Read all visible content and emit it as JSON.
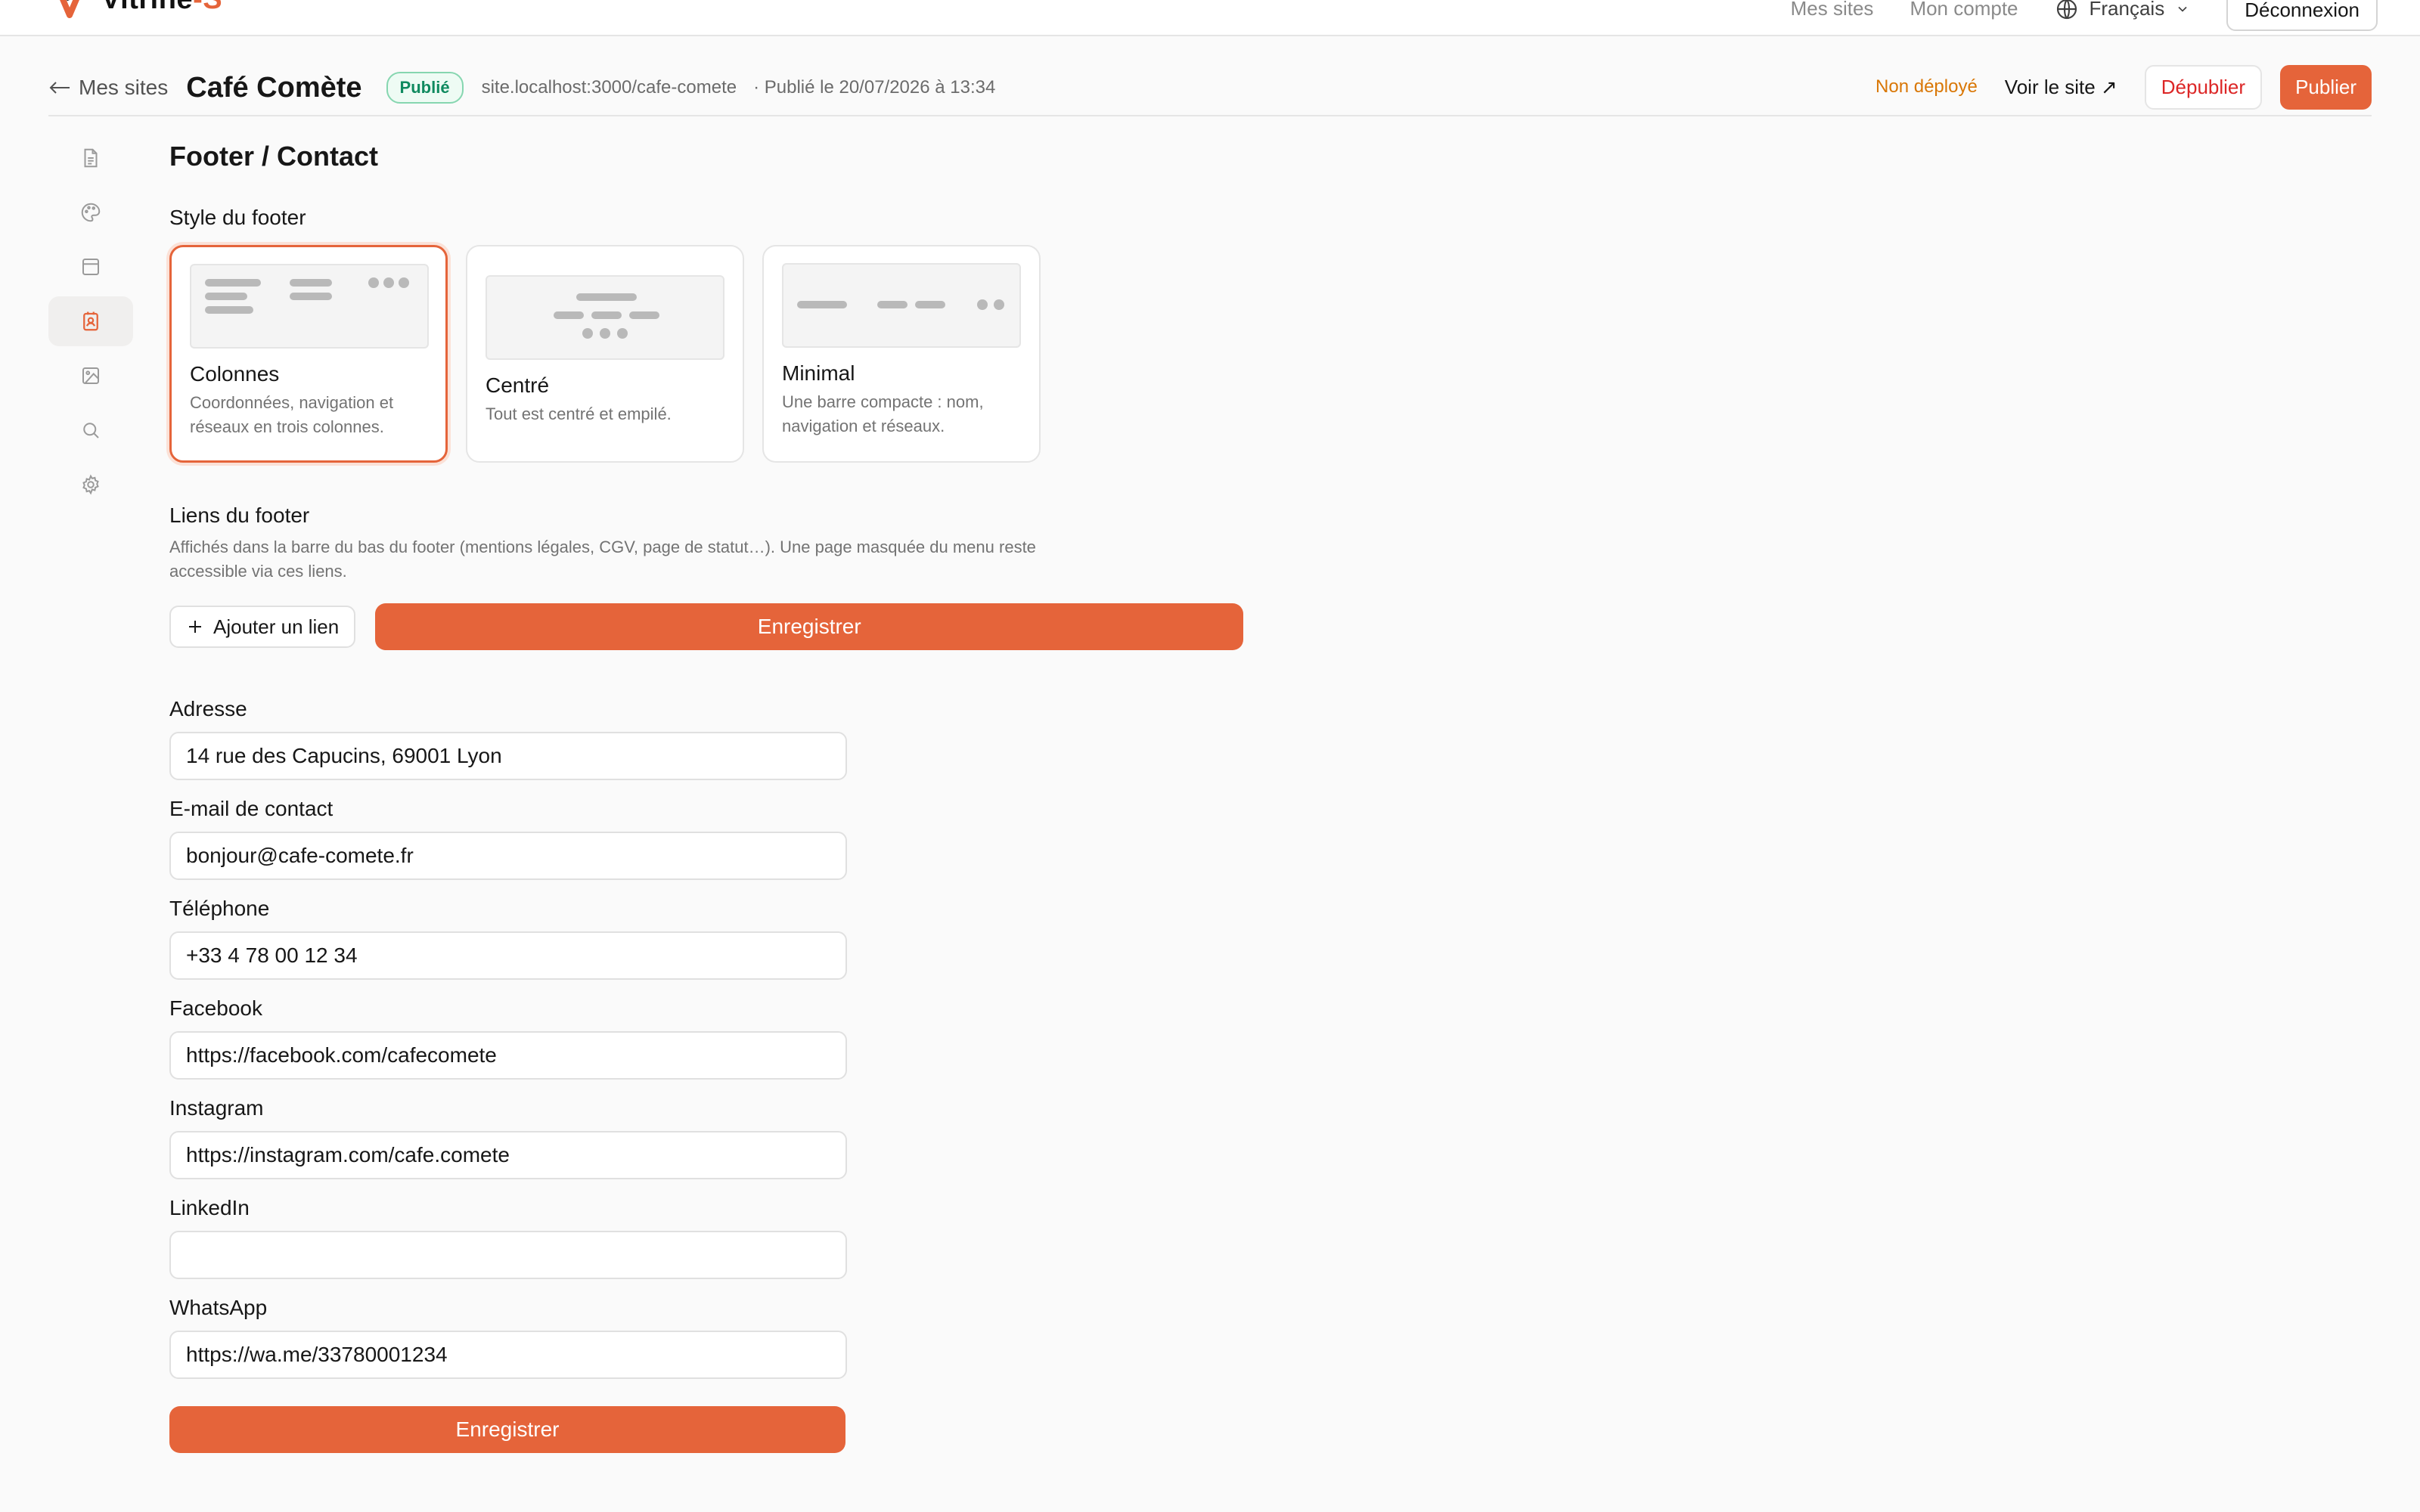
{
  "brand": {
    "name_main": "Vitrine",
    "name_accent": "-S",
    "logo_icon": "v-logo-icon",
    "accent_color": "#e5643a"
  },
  "topnav": {
    "my_sites": "Mes sites",
    "my_account": "Mon compte",
    "language": "Français",
    "logout": "Déconnexion"
  },
  "site": {
    "back_label": "Mes sites",
    "title": "Café Comète",
    "status": "Publié",
    "url": "site.localhost:3000/cafe-comete",
    "published_on": "· Publié le 20/07/2026 à 13:34",
    "deploy_status": "Non déployé",
    "view_site": "Voir le site ↗",
    "unpublish": "Dépublier",
    "publish": "Publier"
  },
  "sidebar": {
    "items": [
      {
        "icon": "file-text-icon",
        "active": false
      },
      {
        "icon": "palette-icon",
        "active": false
      },
      {
        "icon": "layout-icon",
        "active": false
      },
      {
        "icon": "contact-icon",
        "active": true
      },
      {
        "icon": "image-icon",
        "active": false
      },
      {
        "icon": "search-icon",
        "active": false
      },
      {
        "icon": "gear-icon",
        "active": false
      }
    ]
  },
  "page": {
    "title": "Footer / Contact"
  },
  "footer_style": {
    "label": "Style du footer",
    "options": [
      {
        "title": "Colonnes",
        "desc": "Coordonnées, navigation et réseaux en trois colonnes.",
        "selected": true
      },
      {
        "title": "Centré",
        "desc": "Tout est centré et empilé.",
        "selected": false
      },
      {
        "title": "Minimal",
        "desc": "Une barre compacte : nom, navigation et réseaux.",
        "selected": false
      }
    ]
  },
  "footer_links": {
    "label": "Liens du footer",
    "desc": "Affichés dans la barre du bas du footer (mentions légales, CGV, page de statut…). Une page masquée du menu reste accessible via ces liens.",
    "add_label": "Ajouter un lien",
    "save_label": "Enregistrer"
  },
  "contact": {
    "address_label": "Adresse",
    "address_value": "14 rue des Capucins, 69001 Lyon",
    "email_label": "E-mail de contact",
    "email_value": "bonjour@cafe-comete.fr",
    "phone_label": "Téléphone",
    "phone_value": "+33 4 78 00 12 34",
    "facebook_label": "Facebook",
    "facebook_value": "https://facebook.com/cafecomete",
    "instagram_label": "Instagram",
    "instagram_value": "https://instagram.com/cafe.comete",
    "linkedin_label": "LinkedIn",
    "linkedin_value": "",
    "whatsapp_label": "WhatsApp",
    "whatsapp_value": "https://wa.me/33780001234",
    "save_label": "Enregistrer"
  }
}
